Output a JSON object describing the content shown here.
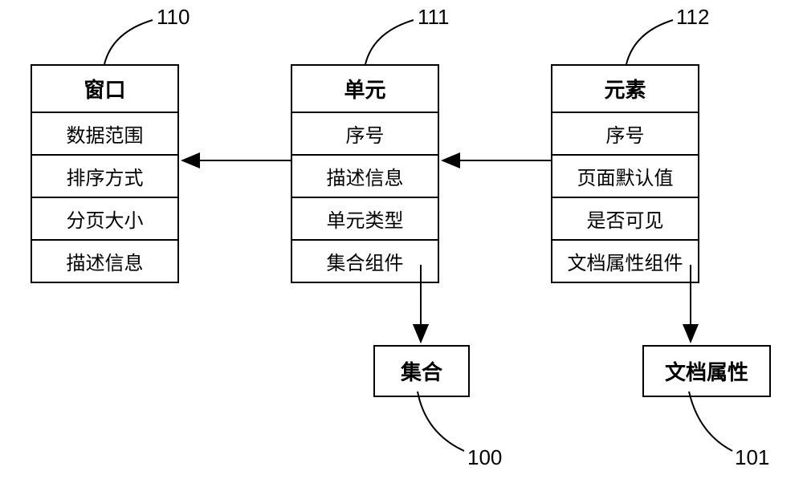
{
  "entities": [
    {
      "id": "110",
      "title": "窗口",
      "attributes": [
        "数据范围",
        "排序方式",
        "分页大小",
        "描述信息"
      ]
    },
    {
      "id": "111",
      "title": "单元",
      "attributes": [
        "序号",
        "描述信息",
        "单元类型",
        "集合组件"
      ]
    },
    {
      "id": "112",
      "title": "元素",
      "attributes": [
        "序号",
        "页面默认值",
        "是否可见",
        "文档属性组件"
      ]
    }
  ],
  "child_boxes": [
    {
      "id": "100",
      "title": "集合"
    },
    {
      "id": "101",
      "title": "文档属性"
    }
  ],
  "labels": {
    "n110": "110",
    "n111": "111",
    "n112": "112",
    "n100": "100",
    "n101": "101"
  }
}
